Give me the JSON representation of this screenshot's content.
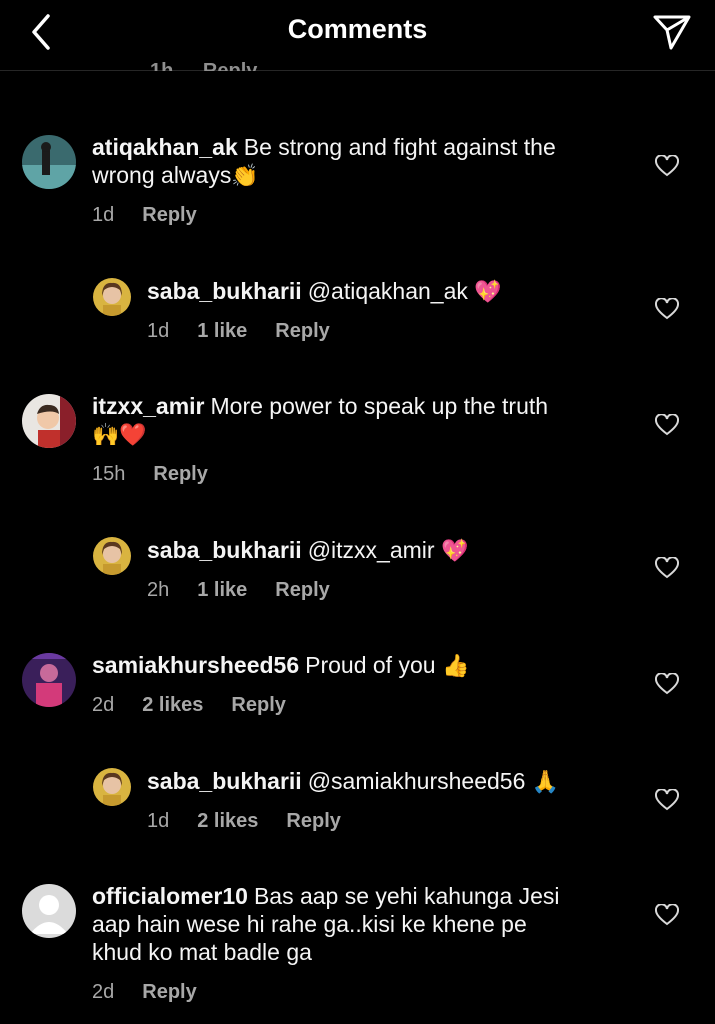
{
  "header": {
    "title": "Comments"
  },
  "partial_row": {
    "time": "1h",
    "reply": "Reply"
  },
  "comments": [
    {
      "user": "atiqakhan_ak",
      "text": "Be strong and fight against the",
      "text2": "wrong always",
      "emoji": "👏",
      "time": "1d",
      "likes": "",
      "reply": "Reply"
    },
    {
      "user": "saba_bukharii",
      "text": "@atiqakhan_ak",
      "emoji": "💖",
      "time": "1d",
      "likes": "1 like",
      "reply": "Reply"
    },
    {
      "user": "itzxx_amir",
      "text": "More power to speak up the truth",
      "emoji": "🙌❤️",
      "time": "15h",
      "likes": "",
      "reply": "Reply"
    },
    {
      "user": "saba_bukharii",
      "text": "@itzxx_amir",
      "emoji": "💖",
      "time": "2h",
      "likes": "1 like",
      "reply": "Reply"
    },
    {
      "user": "samiakhursheed56",
      "text": "Proud of you",
      "emoji": "👍",
      "time": "2d",
      "likes": "2 likes",
      "reply": "Reply"
    },
    {
      "user": "saba_bukharii",
      "text": "@samiakhursheed56",
      "emoji": "🙏",
      "time": "1d",
      "likes": "2 likes",
      "reply": "Reply"
    },
    {
      "user": "officialomer10",
      "text": "Bas aap se yehi kahunga Jesi",
      "text2": "aap hain wese hi rahe ga..kisi ke khene pe",
      "text3": "khud ko mat badle ga",
      "time": "2d",
      "likes": "",
      "reply": "Reply"
    }
  ],
  "colors": {
    "background": "#000000",
    "text": "#f5f5f5",
    "muted": "#a8a8a8"
  }
}
